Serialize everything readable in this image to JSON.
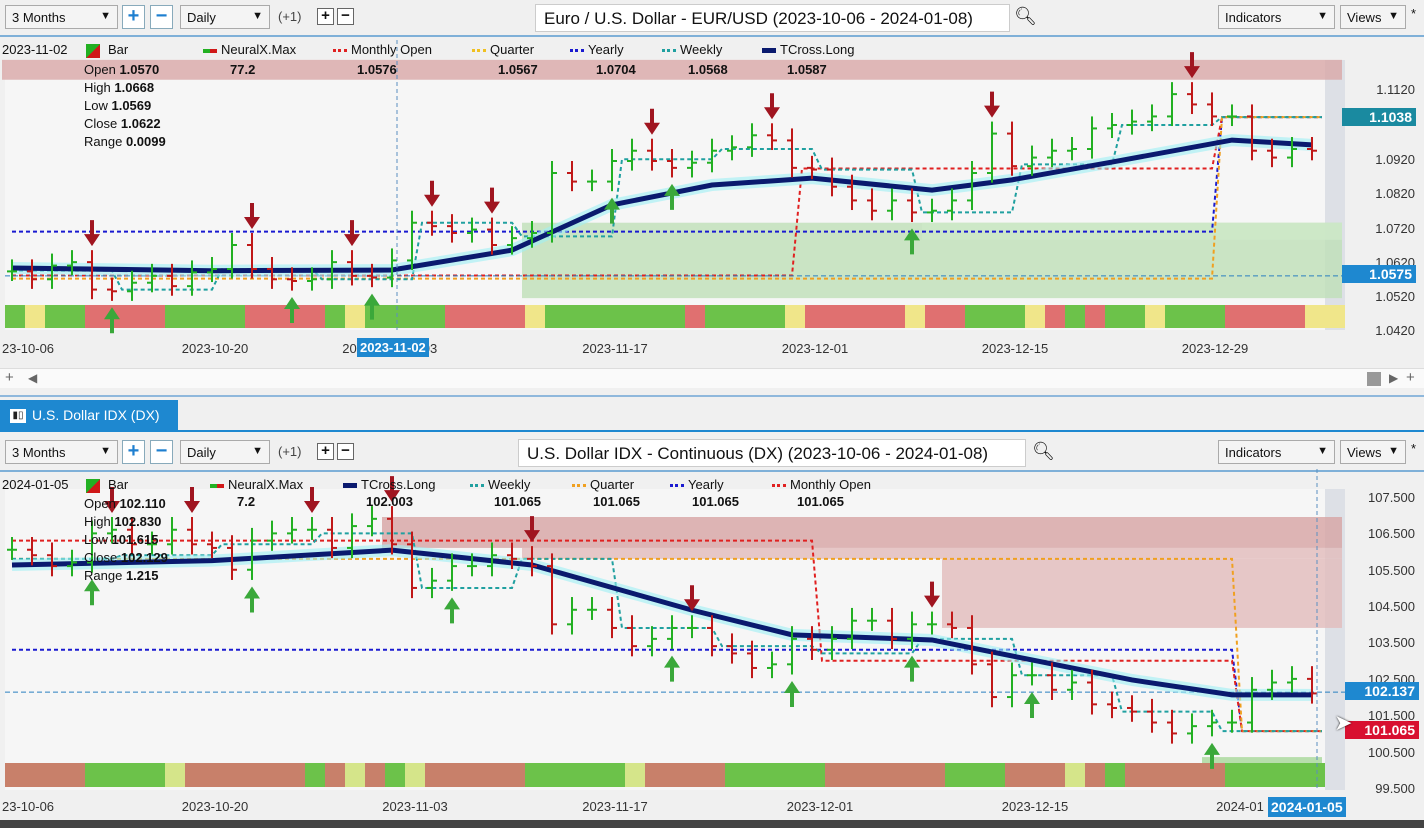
{
  "top": {
    "period_select": "3 Months",
    "interval_select": "Daily",
    "offset": "(+1)",
    "title": "Euro / U.S. Dollar - EUR/USD (2023-10-06 - 2024-01-08)",
    "indicators_label": "Indicators",
    "views_label": "Views",
    "star": "*",
    "legend": {
      "date": "2023-11-02",
      "bar": "Bar",
      "neuralx": "NeuralX.Max",
      "monthly": "Monthly Open",
      "quarter": "Quarter",
      "yearly": "Yearly",
      "weekly": "Weekly",
      "tcross": "TCross.Long"
    },
    "values": {
      "neuralx": "77.2",
      "monthly": "1.0576",
      "quarter": "1.0567",
      "yearly": "1.0704",
      "weekly": "1.0568",
      "tcross": "1.0587"
    },
    "ohlc": [
      {
        "k": "Open",
        "v": "1.0570"
      },
      {
        "k": "High",
        "v": "1.0668"
      },
      {
        "k": "Low",
        "v": "1.0569"
      },
      {
        "k": "Close",
        "v": "1.0622"
      },
      {
        "k": "Range",
        "v": "0.0099"
      }
    ],
    "crosshair_date": "2023-11-02",
    "price_labels": {
      "weekly": "1.1038",
      "current": "1.0575"
    }
  },
  "tab": {
    "label": "U.S. Dollar IDX (DX)",
    "icon": "candlestick-chart-icon"
  },
  "bottom": {
    "period_select": "3 Months",
    "interval_select": "Daily",
    "offset": "(+1)",
    "title": "U.S. Dollar IDX - Continuous (DX) (2023-10-06 - 2024-01-08)",
    "indicators_label": "Indicators",
    "views_label": "Views",
    "star": "*",
    "legend": {
      "date": "2024-01-05",
      "bar": "Bar",
      "neuralx": "NeuralX.Max",
      "tcross": "TCross.Long",
      "weekly": "Weekly",
      "quarter": "Quarter",
      "yearly": "Yearly",
      "monthly": "Monthly Open"
    },
    "values": {
      "neuralx": "7.2",
      "tcross": "102.003",
      "weekly": "101.065",
      "quarter": "101.065",
      "yearly": "101.065",
      "monthly": "101.065"
    },
    "ohlc": [
      {
        "k": "Open",
        "v": "102.110"
      },
      {
        "k": "High",
        "v": "102.830"
      },
      {
        "k": "Low",
        "v": "101.615"
      },
      {
        "k": "Close",
        "v": "102.129"
      },
      {
        "k": "Range",
        "v": "1.215"
      }
    ],
    "crosshair_date": "2024-01-05",
    "price_labels": {
      "current": "102.137",
      "levels": "101.065"
    }
  },
  "colors": {
    "up": "#22b022",
    "down": "#c01818",
    "tcross": "#0a1a6e",
    "yearly": "#1a1ad0",
    "monthly": "#e02020",
    "quarter": "#f0a020",
    "weekly": "#20a0a0",
    "current_box": "#1e88d0",
    "weekly_box": "#1a8aa0",
    "level_box": "#d81030",
    "tab": "#1e88d0"
  },
  "chart_data": [
    {
      "type": "bar",
      "title": "Euro / U.S. Dollar - EUR/USD (2023-10-06 - 2024-01-08)",
      "date_range": [
        "2023-10-06",
        "2024-01-08"
      ],
      "x_ticks": [
        "23-10-06",
        "2023-10-20",
        "2023-11-02",
        "03",
        "2023-11-17",
        "2023-12-01",
        "2023-12-15",
        "2023-12-29"
      ],
      "y_ticks": [
        "1.1120",
        "1.0920",
        "1.0820",
        "1.0720",
        "1.0620",
        "1.0520",
        "1.0420"
      ],
      "ylim": [
        1.042,
        1.121
      ],
      "closes": [
        1.0588,
        1.0565,
        1.0605,
        1.0615,
        1.0535,
        1.053,
        1.0555,
        1.0575,
        1.0545,
        1.0585,
        1.0595,
        1.0665,
        1.0595,
        1.0565,
        1.056,
        1.0565,
        1.0615,
        1.0575,
        1.057,
        1.062,
        1.073,
        1.072,
        1.07,
        1.071,
        1.0665,
        1.0685,
        1.07,
        1.0875,
        1.085,
        1.085,
        1.091,
        1.094,
        1.091,
        1.089,
        1.0905,
        1.094,
        1.095,
        1.0985,
        1.097,
        1.089,
        1.0885,
        1.0835,
        1.0795,
        1.0765,
        1.0795,
        1.076,
        1.0765,
        1.0795,
        1.0875,
        1.099,
        1.0895,
        1.092,
        1.094,
        1.0945,
        1.1005,
        1.1015,
        1.1025,
        1.104,
        1.1105,
        1.1075,
        1.104,
        1.104,
        1.094,
        1.092,
        1.0945,
        1.094
      ],
      "tcross": [
        [
          0,
          1.0598
        ],
        [
          10,
          1.059
        ],
        [
          19,
          1.0592
        ],
        [
          25,
          1.065
        ],
        [
          30,
          1.0782
        ],
        [
          35,
          1.084
        ],
        [
          40,
          1.086
        ],
        [
          46,
          1.0825
        ],
        [
          50,
          1.0855
        ],
        [
          55,
          1.0907
        ],
        [
          61,
          1.0971
        ],
        [
          65,
          1.0957
        ]
      ],
      "levels": {
        "yearly": [
          [
            0,
            60,
            1.0704
          ],
          [
            60.5,
            65.5,
            1.1038
          ]
        ],
        "monthly": [
          [
            0,
            39,
            1.0576
          ],
          [
            39.5,
            60,
            1.0888
          ],
          [
            60.5,
            65.5,
            1.1038
          ]
        ],
        "quarter": [
          [
            0,
            60,
            1.0567
          ],
          [
            60.5,
            65.5,
            1.1038
          ]
        ],
        "weekly": [
          [
            0,
            5,
            1.059
          ],
          [
            5.5,
            10,
            1.0535
          ],
          [
            10.5,
            15,
            1.0595
          ],
          [
            15.5,
            20,
            1.0565
          ],
          [
            20.5,
            25,
            1.073
          ],
          [
            25.5,
            30,
            1.069
          ],
          [
            30.5,
            35,
            1.0915
          ],
          [
            35.5,
            40,
            1.0945
          ],
          [
            40.5,
            45,
            1.0885
          ],
          [
            45.5,
            50,
            1.076
          ],
          [
            50.5,
            55,
            1.09
          ],
          [
            55.5,
            60,
            1.1015
          ],
          [
            60.5,
            65.5,
            1.1038
          ]
        ]
      },
      "zones": [
        {
          "from": -0.5,
          "to": 66.5,
          "hi": 1.1205,
          "lo": 1.1147,
          "color": "#d9a8a8"
        },
        {
          "from": 25.5,
          "to": 66.5,
          "hi": 1.073,
          "lo": 1.051,
          "color": "#bfe0b8"
        },
        {
          "from": 45.5,
          "to": 66.5,
          "hi": 1.073,
          "lo": 1.068,
          "color": "#cde8c8"
        }
      ],
      "down_arrows": [
        4,
        12,
        17,
        21,
        24,
        32,
        38,
        49,
        59
      ],
      "up_arrows": [
        5,
        14,
        18,
        30,
        33,
        45
      ],
      "regime": "gyggrrrrggggrrrrgyggggrrrrygggggggrggggyrrrrryrrgggyrgrggygggrrrryy"
    },
    {
      "type": "bar",
      "title": "U.S. Dollar IDX - Continuous (DX) (2023-10-06 - 2024-01-08)",
      "date_range": [
        "2023-10-06",
        "2024-01-08"
      ],
      "x_ticks": [
        "23-10-06",
        "2023-10-20",
        "2023-11-03",
        "2023-11-17",
        "2023-12-01",
        "2023-12-15",
        "2024-01",
        "2024-01-05"
      ],
      "y_ticks": [
        "107.500",
        "106.500",
        "105.500",
        "104.500",
        "103.500",
        "102.500",
        "101.500",
        "100.500",
        "99.500"
      ],
      "ylim": [
        99.5,
        107.5
      ],
      "closes": [
        106.05,
        105.9,
        105.6,
        105.7,
        106.5,
        106.6,
        106.2,
        106.2,
        106.6,
        106.2,
        106.1,
        105.5,
        106.3,
        106.5,
        106.6,
        106.6,
        106.1,
        106.7,
        106.9,
        106.2,
        105.0,
        105.2,
        105.6,
        105.6,
        105.9,
        105.8,
        105.6,
        104.0,
        104.4,
        104.4,
        103.9,
        103.4,
        103.6,
        103.9,
        103.9,
        103.4,
        103.2,
        102.8,
        102.9,
        103.6,
        103.3,
        103.6,
        104.1,
        104.1,
        103.6,
        104.0,
        104.0,
        103.9,
        102.9,
        102.0,
        102.6,
        102.6,
        102.2,
        102.4,
        101.8,
        101.7,
        101.6,
        101.3,
        101.0,
        101.2,
        101.3,
        101.3,
        102.2,
        102.4,
        102.5,
        102.1
      ],
      "tcross": [
        [
          0,
          105.63
        ],
        [
          10,
          105.75
        ],
        [
          19,
          106.04
        ],
        [
          26,
          105.63
        ],
        [
          34,
          104.39
        ],
        [
          39,
          103.71
        ],
        [
          46,
          103.57
        ],
        [
          51,
          103.02
        ],
        [
          56,
          102.47
        ],
        [
          61,
          102.06
        ],
        [
          65,
          102.06
        ]
      ],
      "levels": {
        "yearly": [
          [
            0,
            61,
            103.3
          ],
          [
            61.5,
            65.5,
            101.065
          ]
        ],
        "monthly": [
          [
            0,
            40,
            106.3
          ],
          [
            40.5,
            61,
            103.0
          ],
          [
            61.5,
            65.5,
            101.065
          ]
        ],
        "quarter": [
          [
            0,
            61,
            105.8
          ],
          [
            61.5,
            65.5,
            101.065
          ]
        ],
        "weekly": [
          [
            0,
            5,
            105.8
          ],
          [
            5.5,
            10,
            105.9
          ],
          [
            10.5,
            15,
            106.2
          ],
          [
            15.5,
            20,
            106.5
          ],
          [
            20.5,
            25,
            105.0
          ],
          [
            25.5,
            30,
            105.8
          ],
          [
            30.5,
            35,
            103.9
          ],
          [
            35.5,
            40,
            103.4
          ],
          [
            40.5,
            45,
            103.2
          ],
          [
            45.5,
            50,
            103.6
          ],
          [
            50.5,
            55,
            102.6
          ],
          [
            55.5,
            60,
            101.6
          ],
          [
            60.5,
            65.5,
            101.065
          ]
        ]
      },
      "zones": [
        {
          "from": 18.5,
          "to": 66.5,
          "hi": 106.95,
          "lo": 106.1,
          "color": "#d7a4a4"
        },
        {
          "from": 25.5,
          "to": 66.5,
          "hi": 106.1,
          "lo": 105.8,
          "color": "#e2bcbc"
        },
        {
          "from": 46.5,
          "to": 66.5,
          "hi": 105.8,
          "lo": 103.9,
          "color": "#e2bcbc"
        },
        {
          "from": 59.5,
          "to": 65.5,
          "hi": 100.35,
          "lo": 99.9,
          "color": "#a8d89a"
        }
      ],
      "down_arrows": [
        5,
        9,
        15,
        19,
        26,
        34,
        46
      ],
      "up_arrows": [
        4,
        12,
        22,
        33,
        39,
        45,
        51,
        60
      ],
      "regime": "rrrrggggyrrrrrrgryrgyrrrrrgggggyrrrrgggggrrrrrrgggrrryrgrrrrrggggg"
    }
  ]
}
